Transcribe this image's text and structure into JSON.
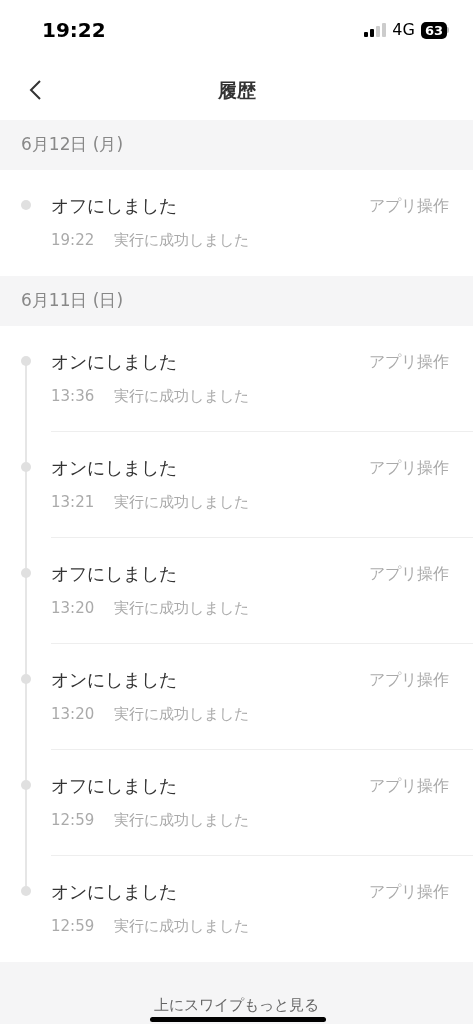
{
  "status_bar": {
    "time": "19:22",
    "network": "4G",
    "battery": "63"
  },
  "header": {
    "title": "履歴"
  },
  "groups": [
    {
      "date": "6月12日 (月)",
      "entries": [
        {
          "action": "オフにしました",
          "source": "アプリ操作",
          "time": "19:22",
          "result": "実行に成功しました"
        }
      ]
    },
    {
      "date": "6月11日 (日)",
      "entries": [
        {
          "action": "オンにしました",
          "source": "アプリ操作",
          "time": "13:36",
          "result": "実行に成功しました"
        },
        {
          "action": "オンにしました",
          "source": "アプリ操作",
          "time": "13:21",
          "result": "実行に成功しました"
        },
        {
          "action": "オフにしました",
          "source": "アプリ操作",
          "time": "13:20",
          "result": "実行に成功しました"
        },
        {
          "action": "オンにしました",
          "source": "アプリ操作",
          "time": "13:20",
          "result": "実行に成功しました"
        },
        {
          "action": "オフにしました",
          "source": "アプリ操作",
          "time": "12:59",
          "result": "実行に成功しました"
        },
        {
          "action": "オンにしました",
          "source": "アプリ操作",
          "time": "12:59",
          "result": "実行に成功しました"
        }
      ]
    }
  ],
  "footer": {
    "hint": "上にスワイプもっと見る"
  }
}
